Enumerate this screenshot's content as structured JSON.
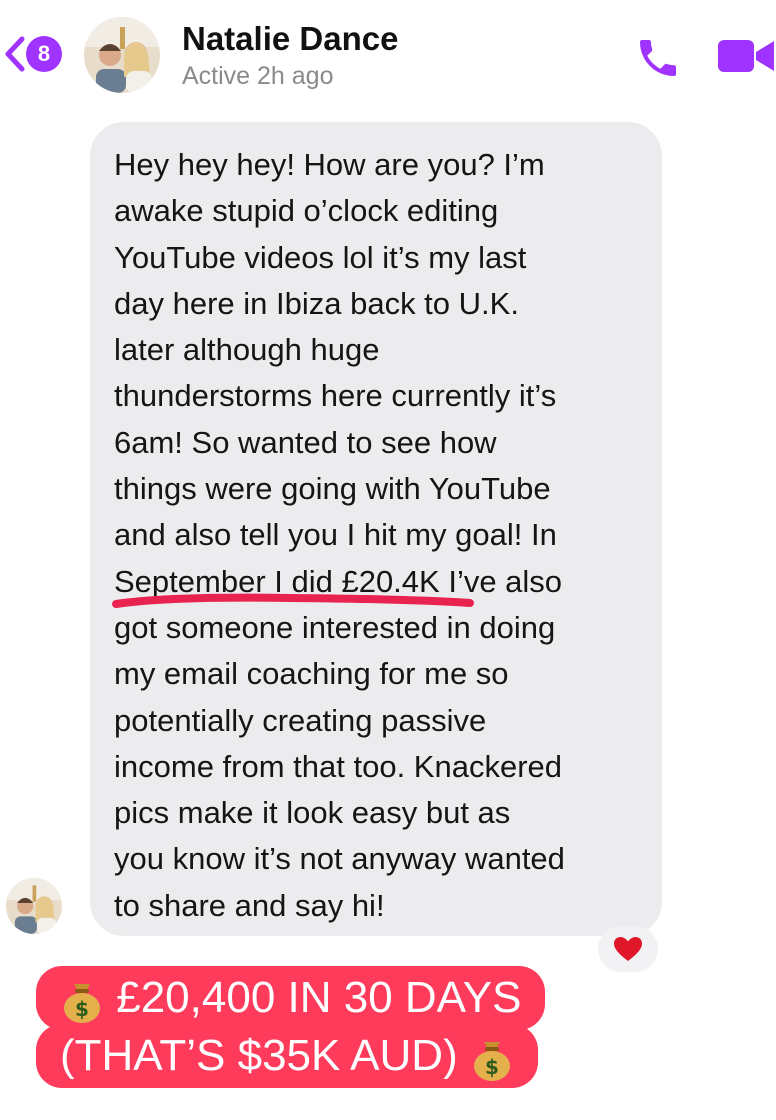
{
  "header": {
    "back_badge": "8",
    "contact_name": "Natalie Dance",
    "status": "Active 2h ago"
  },
  "message": {
    "lines": [
      "Hey hey hey! How are you? I’m",
      "awake stupid o’clock editing",
      "YouTube videos lol it’s my last",
      "day here in Ibiza back to U.K.",
      "later although huge",
      "thunderstorms here currently it’s",
      "6am! So wanted to see how",
      "things were going with YouTube",
      "and also tell you I hit my goal! In",
      "September I did £20.4K I’ve also",
      "got someone interested in doing",
      "my email coaching for me so",
      "potentially creating passive",
      "income from that too. Knackered",
      "pics make it look easy but as",
      "you know it’s not anyway wanted",
      "to share and say hi!"
    ],
    "reaction": "heart"
  },
  "banner": {
    "line1": "£20,400 IN 30 DAYS",
    "line2": "(THAT’S $35K AUD)",
    "icon": "money-bag-icon"
  },
  "colors": {
    "accent": "#a033ff",
    "bubble": "#ececee",
    "banner": "#ff3b5b",
    "underline": "#e8234f"
  }
}
